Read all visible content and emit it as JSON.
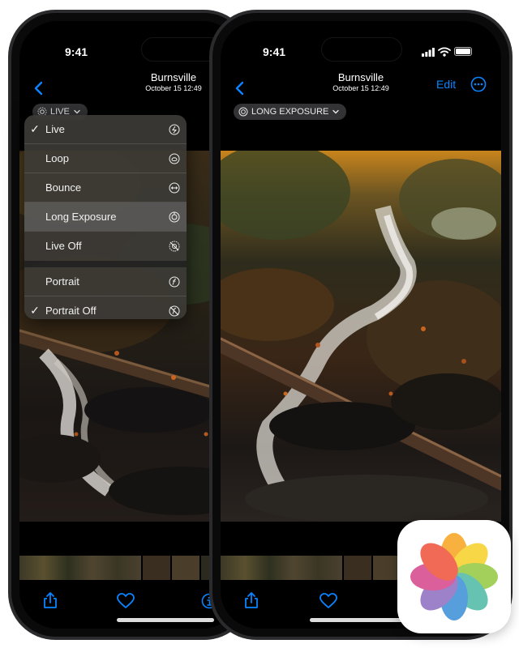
{
  "status": {
    "time": "9:41"
  },
  "header": {
    "title": "Burnsville",
    "subtitle": "October 15  12:49",
    "edit_label": "Edit"
  },
  "left_phone": {
    "mode_label": "LIVE"
  },
  "right_phone": {
    "mode_label": "LONG EXPOSURE"
  },
  "mode_menu": {
    "items": [
      {
        "label": "Live",
        "checked": true,
        "icon": "live-icon"
      },
      {
        "label": "Loop",
        "checked": false,
        "icon": "loop-icon"
      },
      {
        "label": "Bounce",
        "checked": false,
        "icon": "bounce-icon"
      },
      {
        "label": "Long Exposure",
        "checked": false,
        "icon": "long-exposure-icon",
        "highlighted": true
      },
      {
        "label": "Live Off",
        "checked": false,
        "icon": "live-off-icon"
      },
      {
        "label": "Portrait",
        "checked": false,
        "icon": "portrait-icon"
      },
      {
        "label": "Portrait Off",
        "checked": true,
        "icon": "portrait-off-icon"
      }
    ],
    "check_glyph": "✓"
  },
  "toolbar": {
    "icons": [
      "share-icon",
      "heart-icon",
      "info-icon"
    ]
  },
  "colors": {
    "accent": "#0a84ff",
    "menu_bg": "#3c3a36"
  },
  "app_icon": {
    "name": "photos-app-icon"
  }
}
